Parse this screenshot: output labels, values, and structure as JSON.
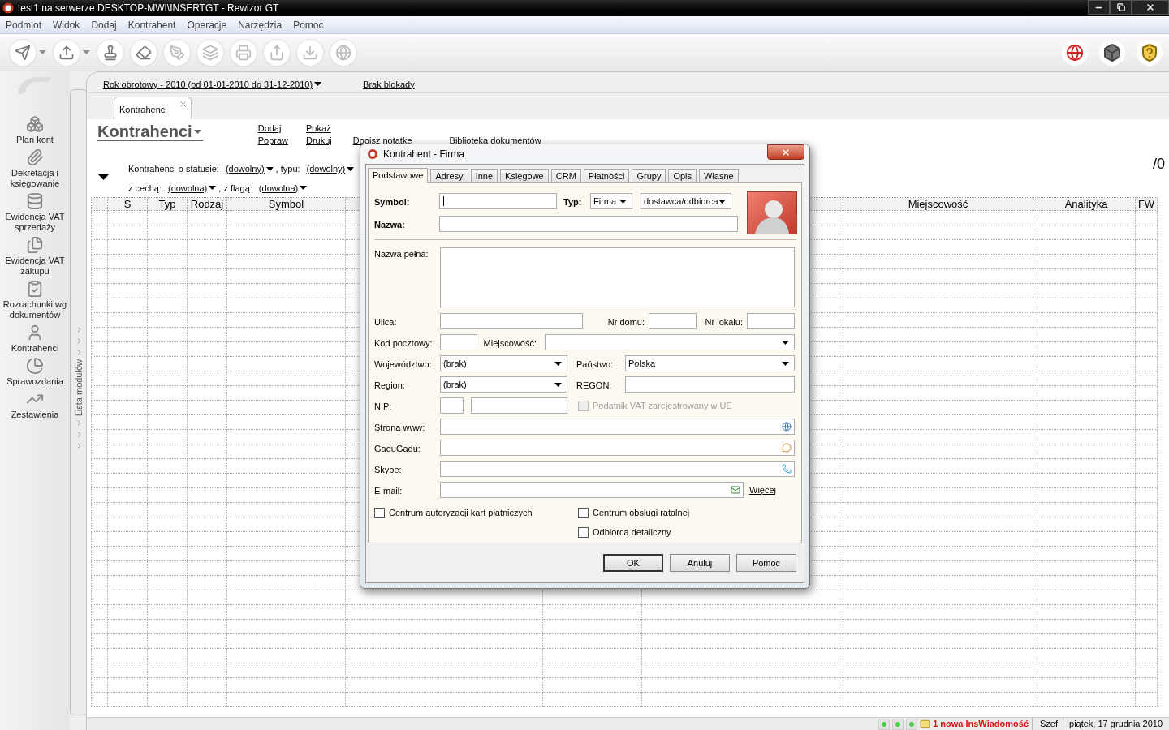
{
  "window": {
    "title": "test1 na serwerze DESKTOP-MWI\\INSERTGT - Rewizor GT"
  },
  "menu": [
    "Podmiot",
    "Widok",
    "Dodaj",
    "Kontrahent",
    "Operacje",
    "Narzędzia",
    "Pomoc"
  ],
  "modules": [
    {
      "label": "Plan kont"
    },
    {
      "label": "Dekretacja i księgowanie"
    },
    {
      "label": "Ewidencja VAT sprzedaży"
    },
    {
      "label": "Ewidencja VAT zakupu"
    },
    {
      "label": "Rozrachunki wg dokumentów"
    },
    {
      "label": "Kontrahenci"
    },
    {
      "label": "Sprawozdania"
    },
    {
      "label": "Zestawienia"
    }
  ],
  "module_list_label": "Lista modułów",
  "period": "Rok obrotowy - 2010  (od 01-01-2010 do 31-12-2010)",
  "lock": "Brak blokady",
  "document_tabs": [
    {
      "label": "Kontrahenci",
      "selected": true
    }
  ],
  "page_title": "Kontrahenci",
  "action_columns": [
    [
      "Dodaj",
      "Popraw"
    ],
    [
      "Pokaż",
      "Drukuj"
    ],
    [
      "Dopisz notatkę"
    ],
    [
      "Biblioteka dokumentów"
    ]
  ],
  "filters": [
    [
      {
        "label": "Kontrahenci o statusie:",
        "value": "(dowolny)"
      },
      {
        "label": ", typu:",
        "value": "(dowolny)"
      }
    ],
    [
      {
        "label": "z cechą:",
        "value": "(dowolna)"
      },
      {
        "label": ", z flagą:",
        "value": "(dowolna)"
      }
    ]
  ],
  "counter": "/0",
  "table": {
    "columns": [
      "S",
      "Typ",
      "Rodzaj",
      "Symbol",
      "Miejscowość",
      "Analityka",
      "FW"
    ]
  },
  "status_bar": {
    "message": "1 nowa InsWiadomość",
    "user": "Szef",
    "date": "piątek, 17 grudnia 2010"
  },
  "dialog": {
    "title": "Kontrahent - Firma",
    "tabs": [
      {
        "label": "Podstawowe",
        "selected": true
      },
      {
        "label": "Adresy",
        "selected": false
      },
      {
        "label": "Inne",
        "selected": false
      },
      {
        "label": "Księgowe",
        "selected": false
      },
      {
        "label": "CRM",
        "selected": false
      },
      {
        "label": "Płatności",
        "selected": false
      },
      {
        "label": "Grupy",
        "selected": false
      },
      {
        "label": "Opis",
        "selected": false
      },
      {
        "label": "Własne",
        "selected": false
      }
    ],
    "symbol": {
      "label": "Symbol:"
    },
    "typ": {
      "label": "Typ:",
      "value": "Firma"
    },
    "role": {
      "value": "dostawca/odbiorca"
    },
    "nazwa": {
      "label": "Nazwa:"
    },
    "nazwa_pelna": {
      "label": "Nazwa pełna:"
    },
    "ulica": {
      "label": "Ulica:"
    },
    "nr_domu": {
      "label": "Nr domu:"
    },
    "nr_lokalu": {
      "label": "Nr lokalu:"
    },
    "kod_pocztowy": {
      "label": "Kod pocztowy:"
    },
    "miejscowosc": {
      "label": "Miejscowość:"
    },
    "wojewodztwo": {
      "label": "Województwo:",
      "value": "(brak)"
    },
    "panstwo": {
      "label": "Państwo:",
      "value": "Polska"
    },
    "region": {
      "label": "Region:",
      "value": "(brak)"
    },
    "regon": {
      "label": "REGON:"
    },
    "nip": {
      "label": "NIP:"
    },
    "vat_ue": {
      "label": "Podatnik VAT zarejestrowany w UE",
      "checked": false,
      "disabled": true
    },
    "www": {
      "label": "Strona www:"
    },
    "gadugadu": {
      "label": "GaduGadu:"
    },
    "skype": {
      "label": "Skype:"
    },
    "email": {
      "label": "E-mail:"
    },
    "more_link": "Więcej",
    "checkboxes": [
      {
        "label": "Centrum autoryzacji kart płatniczych",
        "checked": false
      },
      {
        "label": "Centrum obsługi ratalnej",
        "checked": false
      },
      {
        "label": "Odbiorca detaliczny",
        "checked": false
      }
    ],
    "buttons": [
      "OK",
      "Anuluj",
      "Pomoc"
    ]
  }
}
